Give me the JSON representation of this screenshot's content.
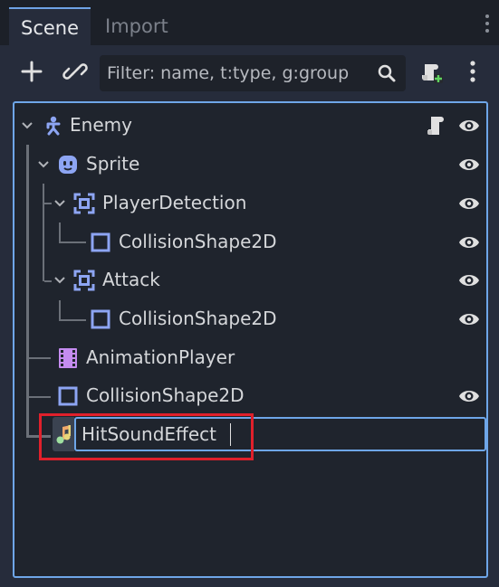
{
  "tabs": [
    {
      "label": "Scene",
      "active": true
    },
    {
      "label": "Import",
      "active": false
    }
  ],
  "toolbar": {
    "add_icon": "plus-icon",
    "link_icon": "link-icon",
    "filter_placeholder": "Filter: name, t:type, g:group",
    "search_icon": "search-icon",
    "add_script_icon": "add-script-icon",
    "menu_icon": "kebab-menu-icon"
  },
  "tree": {
    "nodes": [
      {
        "name": "Enemy",
        "type": "character-body-icon",
        "has_script": true,
        "visible": true
      },
      {
        "name": "Sprite",
        "type": "sprite-icon",
        "visible": true
      },
      {
        "name": "PlayerDetection",
        "type": "area2d-icon",
        "visible": true
      },
      {
        "name": "CollisionShape2D",
        "type": "collision-shape-icon",
        "visible": true
      },
      {
        "name": "Attack",
        "type": "area2d-icon",
        "visible": true
      },
      {
        "name": "CollisionShape2D",
        "type": "collision-shape-icon",
        "visible": true
      },
      {
        "name": "AnimationPlayer",
        "type": "animation-player-icon",
        "visible": false
      },
      {
        "name": "CollisionShape2D",
        "type": "collision-shape-icon",
        "visible": true
      }
    ],
    "editing_node": {
      "value": "HitSoundEffect",
      "type": "audio-stream-player-icon"
    }
  },
  "colors": {
    "accent": "#6ea6e8",
    "node_blue": "#8da5f3",
    "highlight": "#e0202b",
    "audio_orange": "#f0a96b"
  }
}
